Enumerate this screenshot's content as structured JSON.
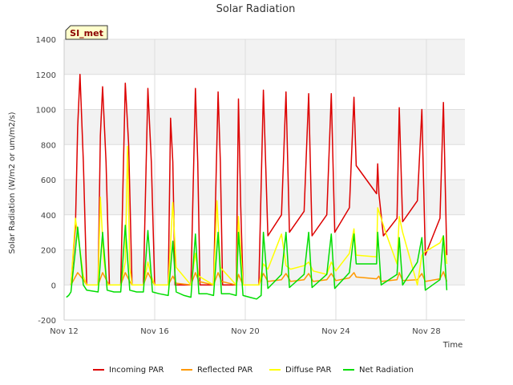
{
  "chart_data": {
    "type": "line",
    "title": "Solar Radiation",
    "xlabel": "Time",
    "ylabel": "Solar Radiation (W/m2 or um/m2/s)",
    "badge": "SI_met",
    "xlim": [
      12,
      29.7
    ],
    "ylim": [
      -200,
      1400
    ],
    "yticks": [
      -200,
      0,
      200,
      400,
      600,
      800,
      1000,
      1200,
      1400
    ],
    "xticks": [
      {
        "value": 12,
        "label": "Nov 12"
      },
      {
        "value": 16,
        "label": "Nov 16"
      },
      {
        "value": 20,
        "label": "Nov 20"
      },
      {
        "value": 24,
        "label": "Nov 24"
      },
      {
        "value": 28,
        "label": "Nov 28"
      }
    ],
    "grid": true,
    "legend_position": "bottom",
    "series": [
      {
        "name": "Incoming PAR",
        "color": "#dd0000",
        "points": [
          [
            12.3,
            0
          ],
          [
            12.5,
            330
          ],
          [
            12.6,
            900
          ],
          [
            12.7,
            1200
          ],
          [
            12.85,
            700
          ],
          [
            13.0,
            0
          ],
          [
            13.5,
            0
          ],
          [
            13.6,
            850
          ],
          [
            13.7,
            1130
          ],
          [
            13.85,
            700
          ],
          [
            14.0,
            0
          ],
          [
            14.5,
            0
          ],
          [
            14.7,
            1150
          ],
          [
            14.85,
            800
          ],
          [
            15.0,
            0
          ],
          [
            15.5,
            0
          ],
          [
            15.7,
            1120
          ],
          [
            15.85,
            700
          ],
          [
            16.0,
            0
          ],
          [
            16.6,
            0
          ],
          [
            16.7,
            950
          ],
          [
            16.8,
            700
          ],
          [
            16.9,
            0
          ],
          [
            17.6,
            0
          ],
          [
            17.8,
            1120
          ],
          [
            17.9,
            700
          ],
          [
            18.0,
            0
          ],
          [
            18.6,
            0
          ],
          [
            18.8,
            1100
          ],
          [
            18.9,
            700
          ],
          [
            19.0,
            0
          ],
          [
            19.6,
            0
          ],
          [
            19.7,
            1060
          ],
          [
            19.8,
            450
          ],
          [
            19.9,
            0
          ],
          [
            20.6,
            0
          ],
          [
            20.8,
            1110
          ],
          [
            21.0,
            280
          ],
          [
            21.6,
            400
          ],
          [
            21.8,
            1100
          ],
          [
            21.95,
            300
          ],
          [
            22.6,
            420
          ],
          [
            22.8,
            1090
          ],
          [
            22.95,
            280
          ],
          [
            23.6,
            400
          ],
          [
            23.8,
            1090
          ],
          [
            23.95,
            300
          ],
          [
            24.6,
            440
          ],
          [
            24.8,
            1070
          ],
          [
            24.9,
            680
          ],
          [
            25.8,
            520
          ],
          [
            25.85,
            690
          ],
          [
            25.9,
            520
          ],
          [
            26.1,
            280
          ],
          [
            26.7,
            380
          ],
          [
            26.8,
            1010
          ],
          [
            26.95,
            360
          ],
          [
            27.6,
            480
          ],
          [
            27.8,
            1000
          ],
          [
            27.95,
            170
          ],
          [
            28.6,
            380
          ],
          [
            28.75,
            1040
          ],
          [
            28.9,
            170
          ]
        ]
      },
      {
        "name": "Reflected PAR",
        "color": "#ff9900",
        "points": [
          [
            12.3,
            0
          ],
          [
            12.6,
            70
          ],
          [
            12.85,
            30
          ],
          [
            13.0,
            0
          ],
          [
            13.5,
            0
          ],
          [
            13.7,
            70
          ],
          [
            13.9,
            20
          ],
          [
            14.0,
            0
          ],
          [
            14.5,
            0
          ],
          [
            14.7,
            70
          ],
          [
            14.9,
            20
          ],
          [
            15.0,
            0
          ],
          [
            15.5,
            0
          ],
          [
            15.7,
            70
          ],
          [
            15.9,
            20
          ],
          [
            16.0,
            0
          ],
          [
            16.6,
            0
          ],
          [
            16.8,
            50
          ],
          [
            16.95,
            10
          ],
          [
            17.6,
            0
          ],
          [
            17.8,
            70
          ],
          [
            17.95,
            20
          ],
          [
            18.6,
            0
          ],
          [
            18.8,
            70
          ],
          [
            18.95,
            20
          ],
          [
            19.6,
            0
          ],
          [
            19.7,
            60
          ],
          [
            19.9,
            0
          ],
          [
            20.6,
            0
          ],
          [
            20.8,
            65
          ],
          [
            21.0,
            20
          ],
          [
            21.6,
            30
          ],
          [
            21.8,
            65
          ],
          [
            22.0,
            20
          ],
          [
            22.6,
            30
          ],
          [
            22.8,
            65
          ],
          [
            23.0,
            20
          ],
          [
            23.6,
            30
          ],
          [
            23.8,
            65
          ],
          [
            24.0,
            25
          ],
          [
            24.6,
            40
          ],
          [
            24.8,
            70
          ],
          [
            24.9,
            45
          ],
          [
            25.8,
            35
          ],
          [
            25.9,
            50
          ],
          [
            26.0,
            20
          ],
          [
            26.7,
            30
          ],
          [
            26.8,
            70
          ],
          [
            26.95,
            25
          ],
          [
            27.6,
            30
          ],
          [
            27.8,
            65
          ],
          [
            27.95,
            20
          ],
          [
            28.6,
            35
          ],
          [
            28.75,
            75
          ],
          [
            28.9,
            20
          ]
        ]
      },
      {
        "name": "Diffuse PAR",
        "color": "#ffff00",
        "points": [
          [
            12.3,
            0
          ],
          [
            12.5,
            380
          ],
          [
            12.7,
            200
          ],
          [
            12.85,
            50
          ],
          [
            13.0,
            0
          ],
          [
            13.5,
            0
          ],
          [
            13.6,
            500
          ],
          [
            13.75,
            150
          ],
          [
            13.9,
            0
          ],
          [
            14.5,
            0
          ],
          [
            14.7,
            130
          ],
          [
            14.8,
            790
          ],
          [
            14.9,
            100
          ],
          [
            15.0,
            0
          ],
          [
            15.5,
            0
          ],
          [
            15.7,
            130
          ],
          [
            15.85,
            50
          ],
          [
            16.0,
            0
          ],
          [
            16.6,
            0
          ],
          [
            16.8,
            470
          ],
          [
            16.95,
            100
          ],
          [
            17.6,
            0
          ],
          [
            17.8,
            180
          ],
          [
            17.95,
            50
          ],
          [
            18.6,
            0
          ],
          [
            18.75,
            480
          ],
          [
            18.9,
            100
          ],
          [
            19.6,
            0
          ],
          [
            19.7,
            390
          ],
          [
            19.9,
            0
          ],
          [
            20.6,
            0
          ],
          [
            20.8,
            120
          ],
          [
            21.0,
            90
          ],
          [
            21.6,
            290
          ],
          [
            21.8,
            110
          ],
          [
            22.0,
            90
          ],
          [
            22.6,
            110
          ],
          [
            22.8,
            130
          ],
          [
            23.0,
            80
          ],
          [
            23.6,
            60
          ],
          [
            23.8,
            130
          ],
          [
            24.0,
            80
          ],
          [
            24.6,
            180
          ],
          [
            24.8,
            320
          ],
          [
            24.9,
            170
          ],
          [
            25.8,
            160
          ],
          [
            25.85,
            440
          ],
          [
            26.0,
            380
          ],
          [
            26.2,
            300
          ],
          [
            26.7,
            120
          ],
          [
            26.8,
            390
          ],
          [
            26.95,
            300
          ],
          [
            27.6,
            0
          ],
          [
            27.8,
            170
          ],
          [
            27.95,
            190
          ],
          [
            28.6,
            240
          ],
          [
            28.75,
            280
          ],
          [
            28.9,
            120
          ]
        ]
      },
      {
        "name": "Net Radiation",
        "color": "#00dd00",
        "points": [
          [
            12.1,
            -70
          ],
          [
            12.2,
            -60
          ],
          [
            12.3,
            -40
          ],
          [
            12.5,
            200
          ],
          [
            12.6,
            330
          ],
          [
            12.85,
            0
          ],
          [
            13.0,
            -30
          ],
          [
            13.5,
            -40
          ],
          [
            13.7,
            300
          ],
          [
            13.9,
            -30
          ],
          [
            14.2,
            -40
          ],
          [
            14.5,
            -40
          ],
          [
            14.7,
            340
          ],
          [
            14.9,
            -30
          ],
          [
            15.2,
            -40
          ],
          [
            15.5,
            -40
          ],
          [
            15.7,
            310
          ],
          [
            15.9,
            -40
          ],
          [
            16.2,
            -50
          ],
          [
            16.6,
            -60
          ],
          [
            16.8,
            250
          ],
          [
            16.95,
            -40
          ],
          [
            17.3,
            -60
          ],
          [
            17.6,
            -70
          ],
          [
            17.8,
            290
          ],
          [
            17.95,
            -50
          ],
          [
            18.3,
            -50
          ],
          [
            18.6,
            -60
          ],
          [
            18.8,
            300
          ],
          [
            18.95,
            -50
          ],
          [
            19.3,
            -50
          ],
          [
            19.6,
            -60
          ],
          [
            19.7,
            300
          ],
          [
            19.9,
            -60
          ],
          [
            20.2,
            -70
          ],
          [
            20.5,
            -80
          ],
          [
            20.7,
            -60
          ],
          [
            20.8,
            300
          ],
          [
            21.0,
            -20
          ],
          [
            21.6,
            60
          ],
          [
            21.8,
            300
          ],
          [
            21.95,
            -15
          ],
          [
            22.6,
            60
          ],
          [
            22.8,
            300
          ],
          [
            22.95,
            -15
          ],
          [
            23.6,
            60
          ],
          [
            23.8,
            290
          ],
          [
            23.95,
            -20
          ],
          [
            24.6,
            70
          ],
          [
            24.8,
            290
          ],
          [
            24.9,
            120
          ],
          [
            25.8,
            120
          ],
          [
            25.85,
            300
          ],
          [
            26.0,
            0
          ],
          [
            26.7,
            60
          ],
          [
            26.8,
            270
          ],
          [
            26.95,
            0
          ],
          [
            27.6,
            130
          ],
          [
            27.8,
            270
          ],
          [
            27.95,
            -30
          ],
          [
            28.6,
            30
          ],
          [
            28.75,
            280
          ],
          [
            28.9,
            -30
          ]
        ]
      }
    ]
  }
}
